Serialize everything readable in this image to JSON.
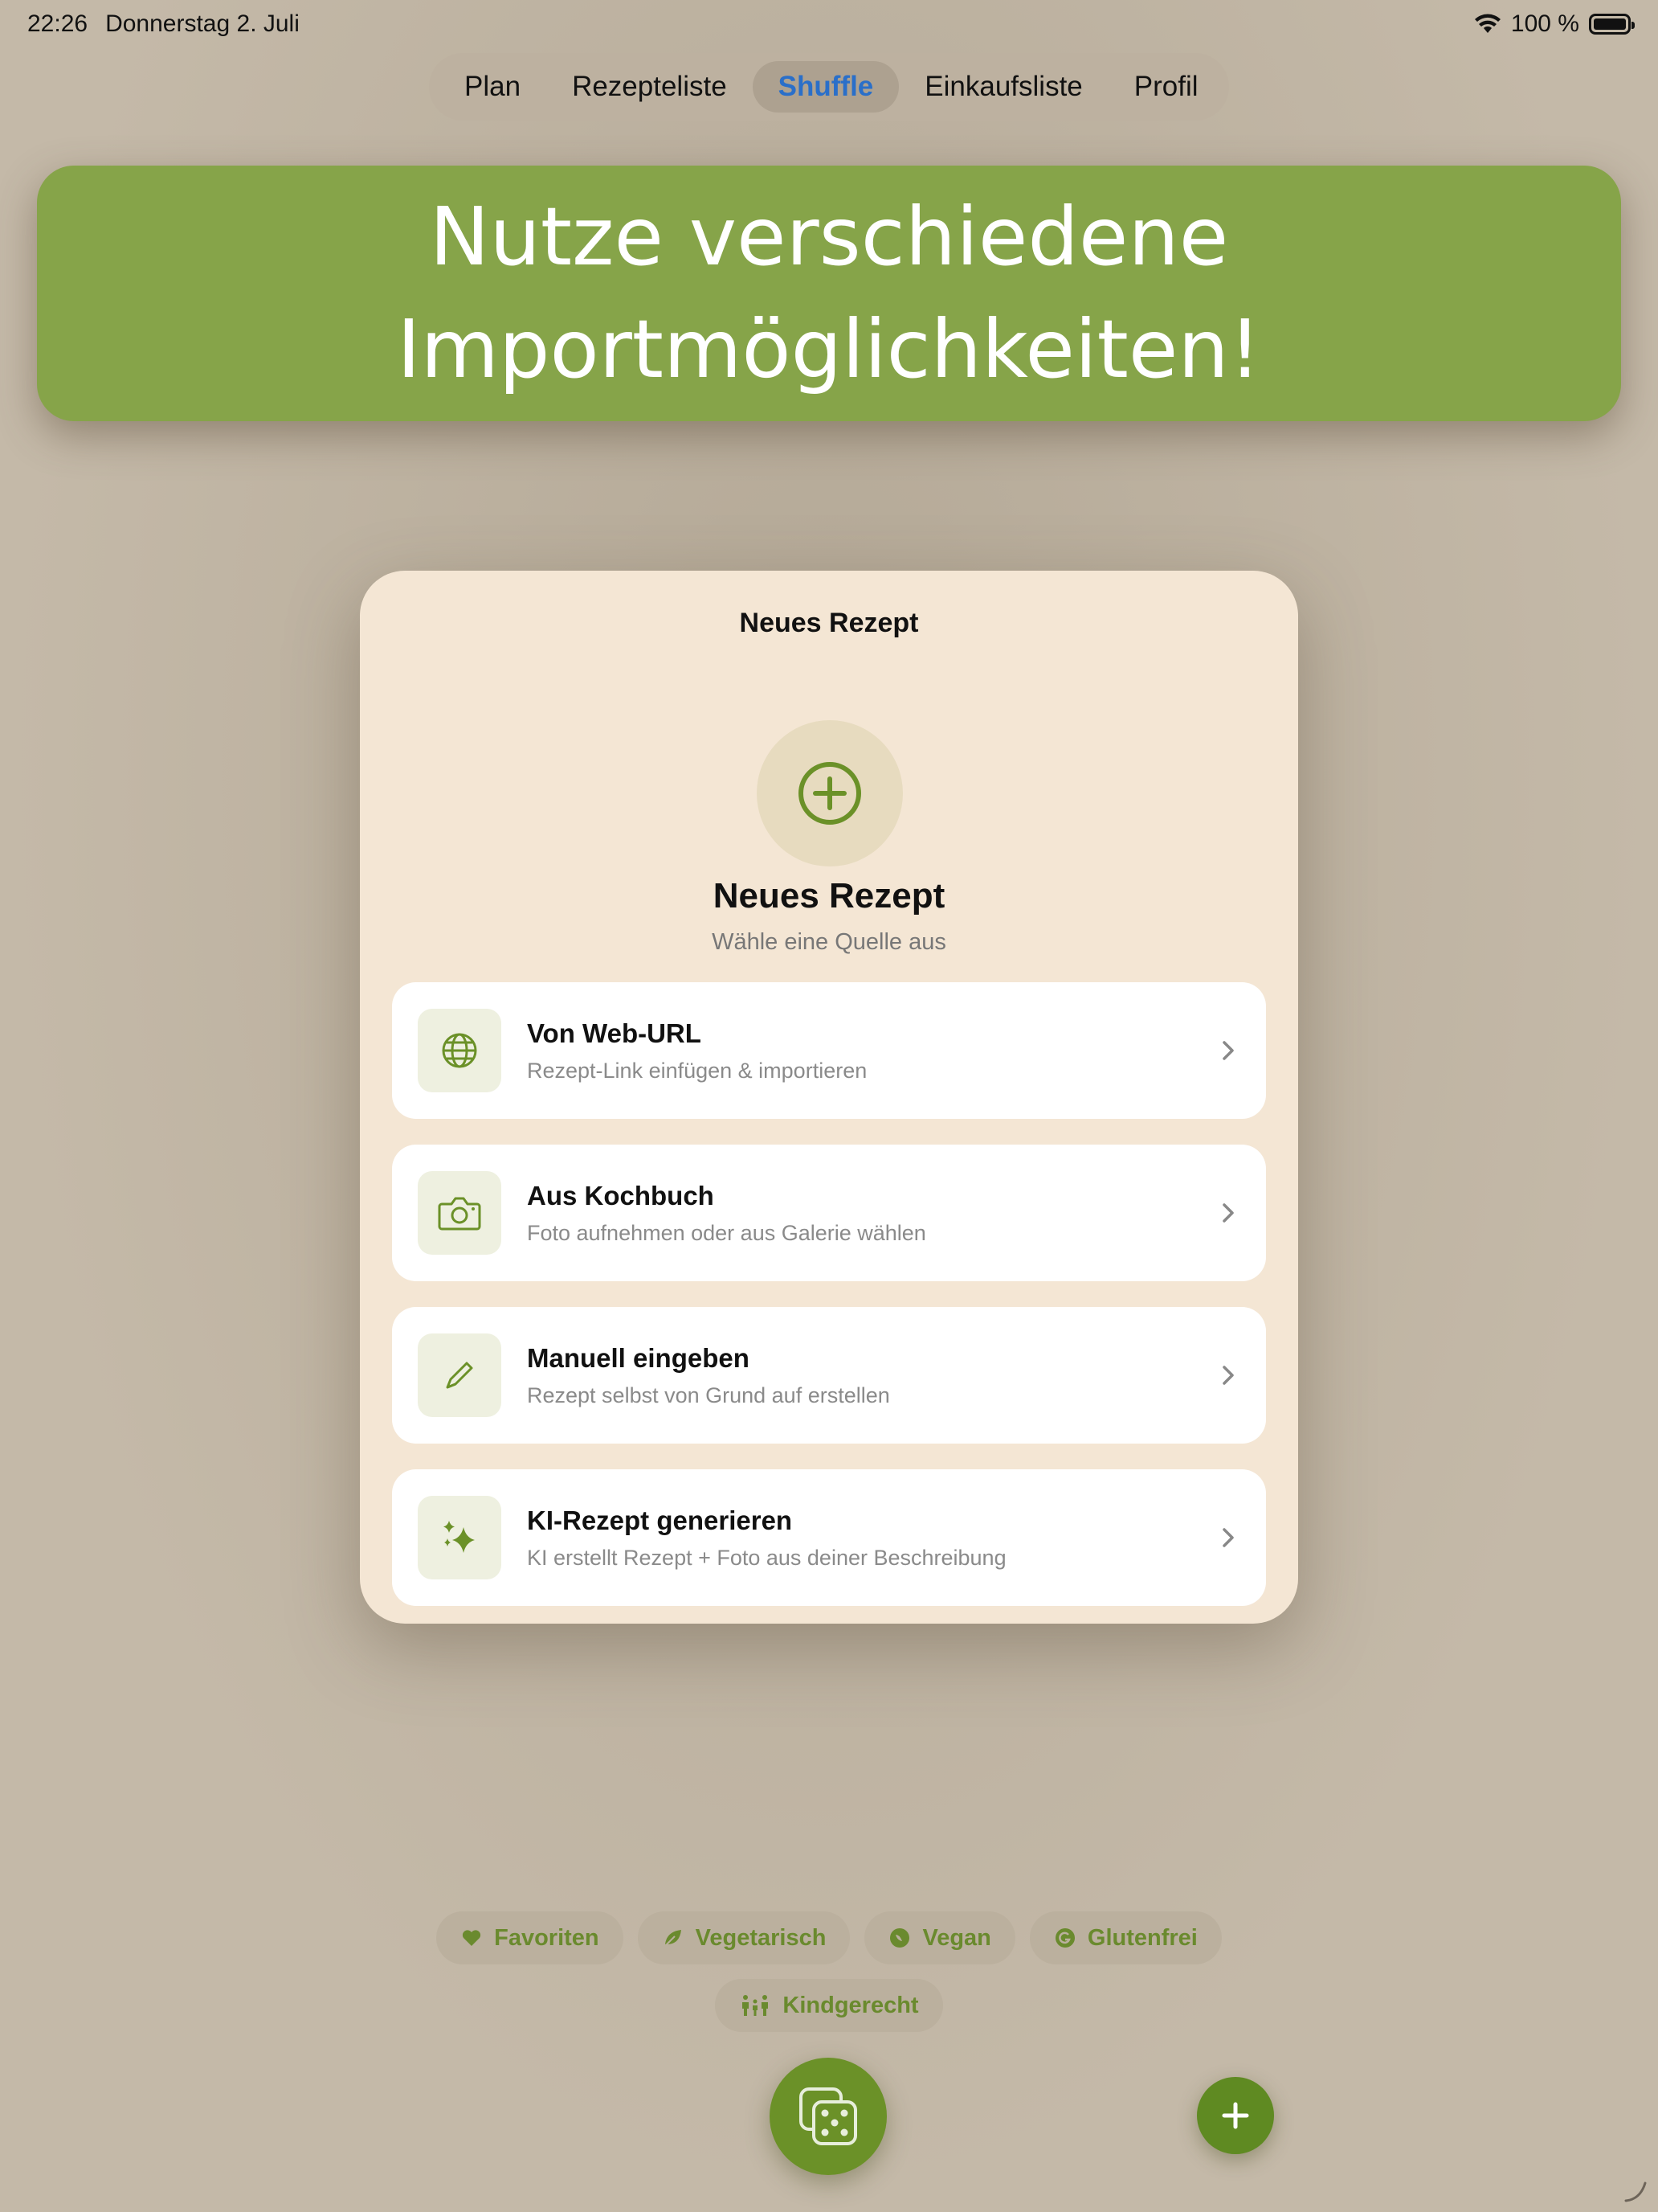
{
  "status_bar": {
    "time": "22:26",
    "date": "Donnerstag 2. Juli",
    "battery": "100 %"
  },
  "tabs": [
    {
      "label": "Plan"
    },
    {
      "label": "Rezepteliste"
    },
    {
      "label": "Shuffle"
    },
    {
      "label": "Einkaufsliste"
    },
    {
      "label": "Profil"
    }
  ],
  "active_tab": "Shuffle",
  "banner": {
    "line1": "Nutze verschiedene",
    "line2": "Importmöglichkeiten!"
  },
  "modal": {
    "title": "Neues Rezept",
    "hero_title": "Neues Rezept",
    "hero_subtitle": "Wähle eine Quelle aus",
    "options": [
      {
        "title": "Von Web-URL",
        "subtitle": "Rezept-Link einfügen & importieren",
        "icon": "globe-icon"
      },
      {
        "title": "Aus Kochbuch",
        "subtitle": "Foto aufnehmen oder aus Galerie wählen",
        "icon": "camera-icon"
      },
      {
        "title": "Manuell eingeben",
        "subtitle": "Rezept selbst von Grund auf erstellen",
        "icon": "pencil-icon"
      },
      {
        "title": "KI-Rezept generieren",
        "subtitle": "KI erstellt Rezept + Foto aus deiner Beschreibung",
        "icon": "sparkles-icon"
      }
    ]
  },
  "filters": [
    {
      "label": "Favoriten",
      "icon": "heart-icon"
    },
    {
      "label": "Vegetarisch",
      "icon": "leaf-icon"
    },
    {
      "label": "Vegan",
      "icon": "vegan-icon"
    },
    {
      "label": "Glutenfrei",
      "icon": "gluten-free-icon"
    },
    {
      "label": "Kindgerecht",
      "icon": "family-icon"
    }
  ],
  "colors": {
    "accent_green": "#6b9128",
    "banner_green": "#86a449",
    "active_tab_blue": "#2a6fc9",
    "background": "#c4b9a8",
    "modal_bg": "#f4e6d4"
  }
}
